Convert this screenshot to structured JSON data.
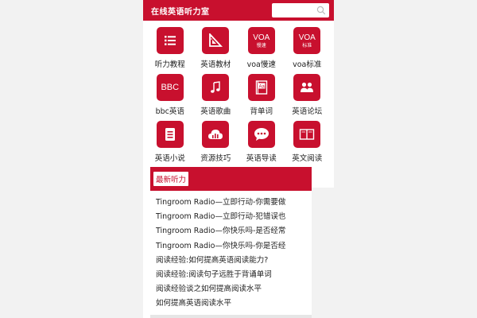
{
  "header": {
    "title": "在线英语听力室",
    "search_placeholder": ""
  },
  "menu": [
    {
      "label": "听力教程",
      "icon": "list-icon",
      "text": ""
    },
    {
      "label": "英语教材",
      "icon": "ruler-triangle-icon",
      "text": ""
    },
    {
      "label": "voa慢速",
      "icon": "voa-slow-icon",
      "text": "VOA",
      "sub": "慢速"
    },
    {
      "label": "voa标准",
      "icon": "voa-standard-icon",
      "text": "VOA",
      "sub": "标准"
    },
    {
      "label": "bbc英语",
      "icon": "bbc-icon",
      "text": "BBC"
    },
    {
      "label": "英语歌曲",
      "icon": "music-note-icon",
      "text": ""
    },
    {
      "label": "背单词",
      "icon": "dictionary-icon",
      "text": ""
    },
    {
      "label": "英语论坛",
      "icon": "users-icon",
      "text": ""
    },
    {
      "label": "英语小说",
      "icon": "document-icon",
      "text": ""
    },
    {
      "label": "资源技巧",
      "icon": "cloud-download-icon",
      "text": ""
    },
    {
      "label": "英语导读",
      "icon": "chat-bubble-icon",
      "text": ""
    },
    {
      "label": "英文阅读",
      "icon": "open-book-icon",
      "text": ""
    }
  ],
  "latest": {
    "title": "最新听力",
    "items": [
      "Tingroom Radio—立即行动-你需要做",
      "Tingroom Radio—立即行动-犯错误也",
      "Tingroom Radio—你快乐吗-是否经常",
      "Tingroom Radio—你快乐吗-你是否经",
      "阅读经验:如何提高英语阅读能力?",
      "阅读经验:阅读句子远胜于背诵单词",
      "阅读经验谈之如何提高阅读水平",
      "如何提高英语阅读水平"
    ]
  },
  "colors": {
    "brand": "#c8102e",
    "background": "#f2f2f2"
  }
}
